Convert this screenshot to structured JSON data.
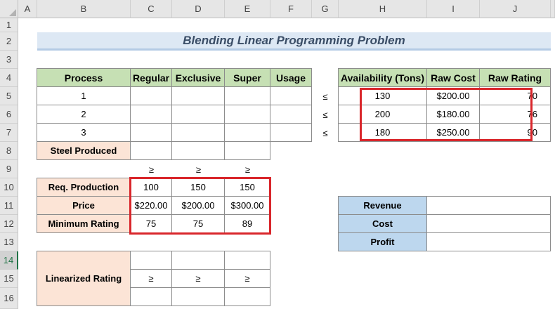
{
  "columns": [
    "A",
    "B",
    "C",
    "D",
    "E",
    "F",
    "G",
    "H",
    "I",
    "J"
  ],
  "rows": [
    "1",
    "2",
    "3",
    "4",
    "5",
    "6",
    "7",
    "8",
    "9",
    "10",
    "11",
    "12",
    "13",
    "14",
    "15",
    "16"
  ],
  "title": "Blending Linear Programming Problem",
  "process_table": {
    "headers": [
      "Process",
      "Regular",
      "Exclusive",
      "Super",
      "Usage"
    ],
    "rows": [
      "1",
      "2",
      "3"
    ],
    "steel_produced_label": "Steel Produced"
  },
  "constraint_signs": {
    "le": "≤",
    "ge": "≥"
  },
  "availability_table": {
    "headers": [
      "Availability (Tons)",
      "Raw Cost",
      "Raw Rating"
    ],
    "rows": [
      [
        "130",
        "$200.00",
        "70"
      ],
      [
        "200",
        "$180.00",
        "76"
      ],
      [
        "180",
        "$250.00",
        "90"
      ]
    ]
  },
  "requirements_table": {
    "rows": [
      {
        "label": "Req. Production",
        "values": [
          "100",
          "150",
          "150"
        ]
      },
      {
        "label": "Price",
        "values": [
          "$220.00",
          "$200.00",
          "$300.00"
        ]
      },
      {
        "label": "Minimum Rating",
        "values": [
          "75",
          "75",
          "89"
        ]
      }
    ]
  },
  "financials": {
    "labels": [
      "Revenue",
      "Cost",
      "Profit"
    ]
  },
  "linearized": {
    "label": "Linearized Rating"
  },
  "colors": {
    "green_header": "#c6e0b4",
    "peach_header": "#fce4d6",
    "blue_header": "#bdd7ee",
    "highlight_border": "#d9262b",
    "title_band": "#dde8f4"
  }
}
